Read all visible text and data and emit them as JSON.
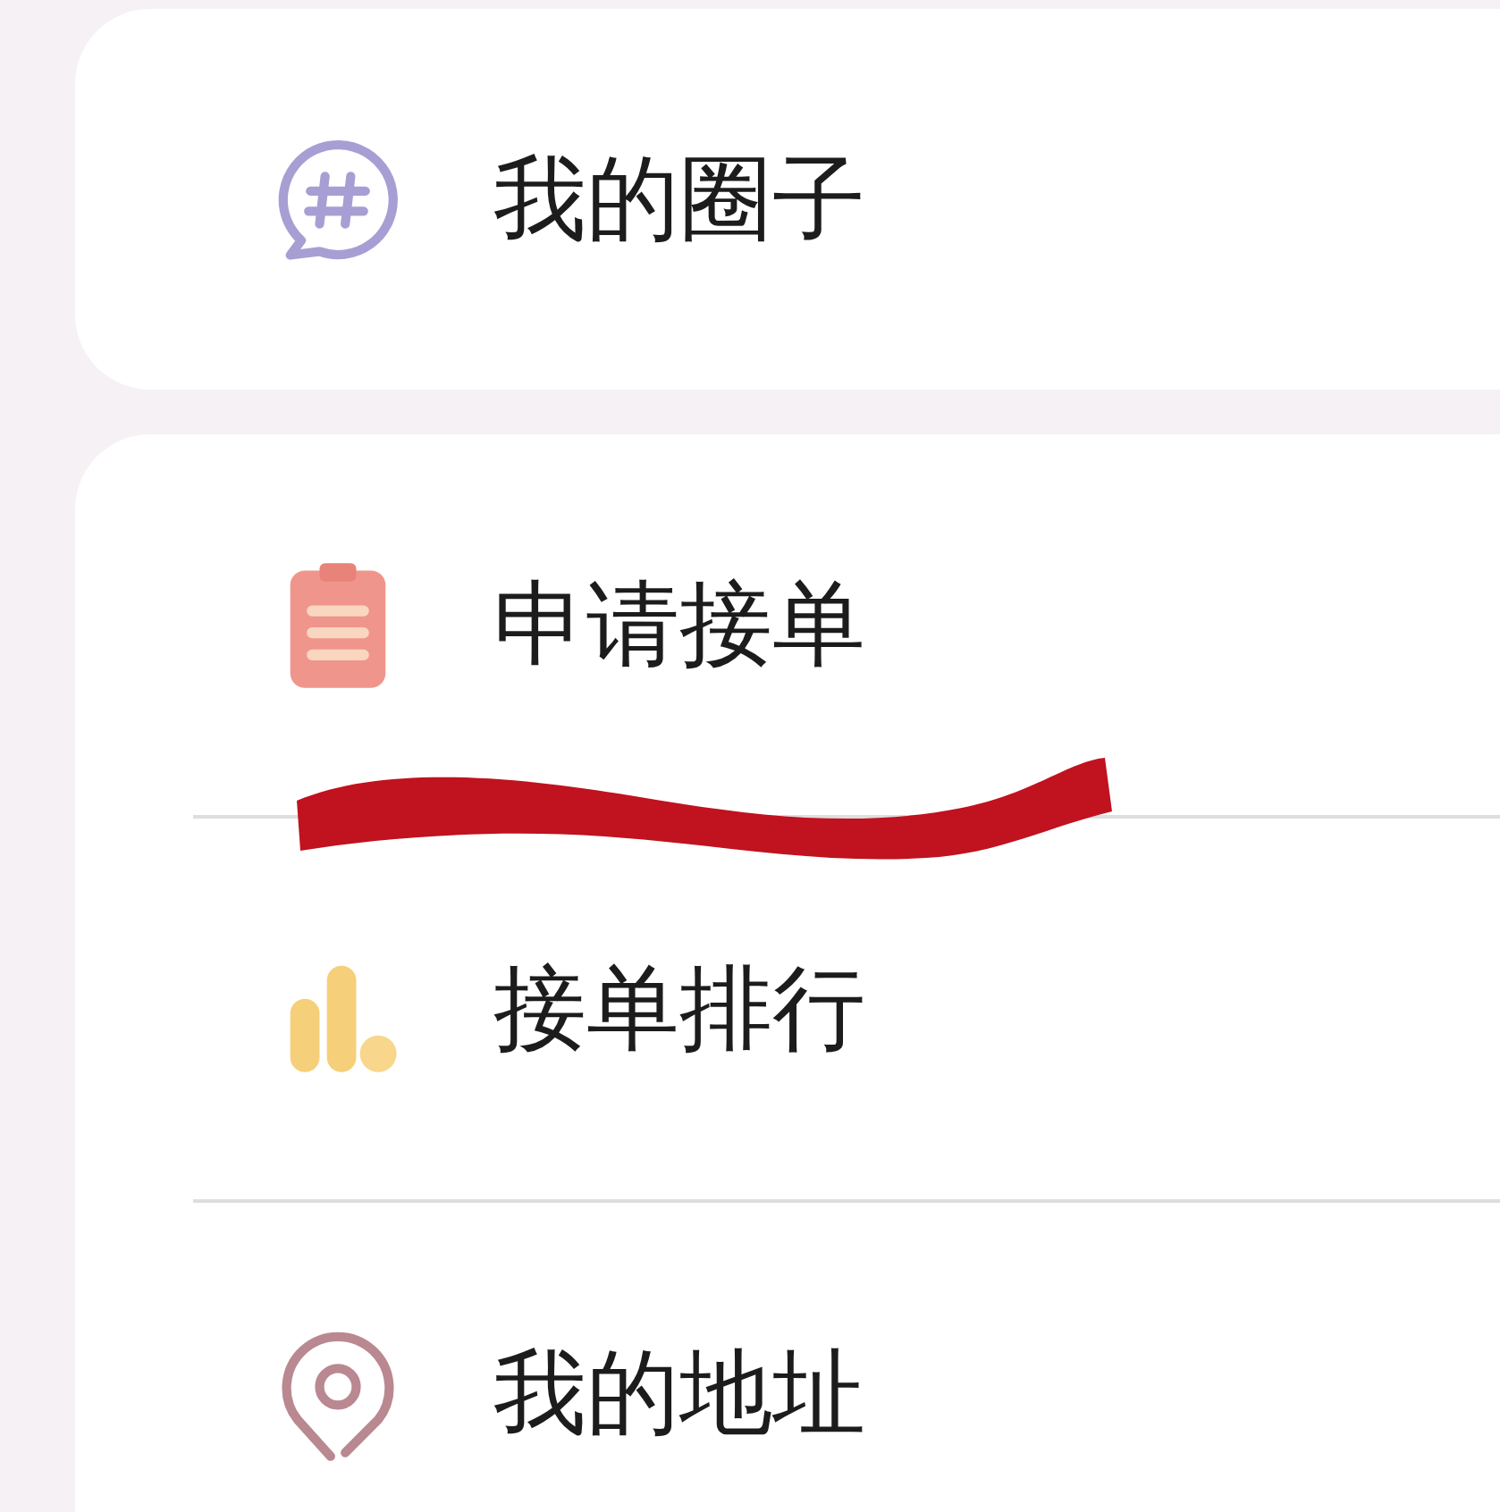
{
  "sections": [
    {
      "items": [
        {
          "label": "我的圈子",
          "kind": "chat"
        }
      ]
    },
    {
      "items": [
        {
          "label": "申请接单",
          "kind": "clipboard"
        },
        {
          "label": "接单排行",
          "kind": "chart"
        },
        {
          "label": "我的地址",
          "kind": "location"
        }
      ]
    }
  ]
}
